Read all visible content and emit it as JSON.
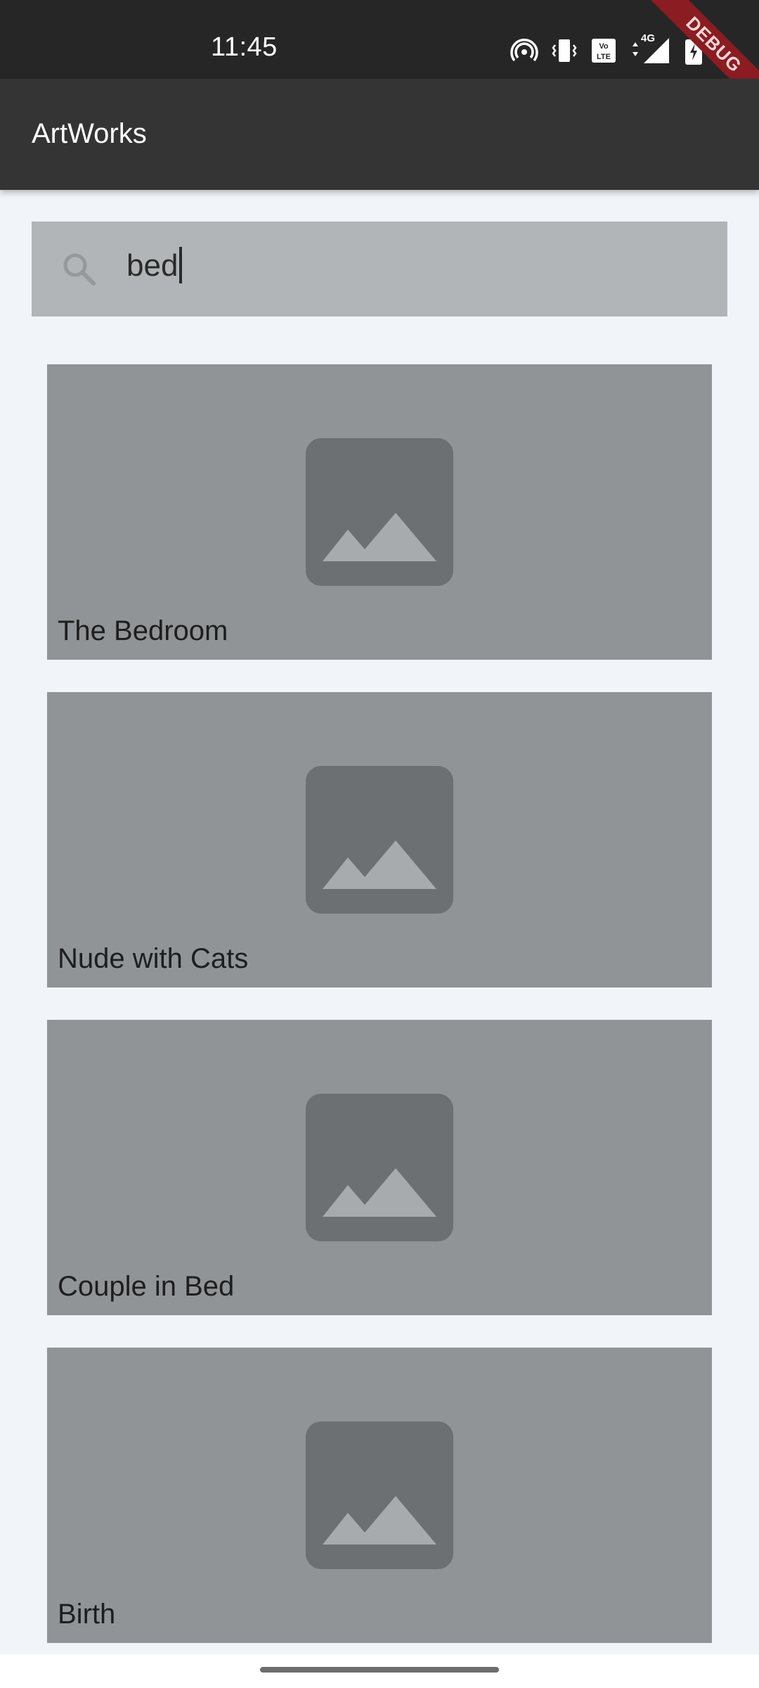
{
  "status_bar": {
    "time": "11:45",
    "icons": [
      "hotspot-icon",
      "vibrate-icon",
      "volte-icon",
      "4g-signal-icon",
      "battery-charging-icon"
    ],
    "network_label": "4G"
  },
  "debug_banner": {
    "label": "DEBUG"
  },
  "app_bar": {
    "title": "ArtWorks"
  },
  "search": {
    "value": "bed",
    "icon": "search-icon"
  },
  "results": [
    {
      "title": "The Bedroom",
      "image_icon": "image-placeholder-icon"
    },
    {
      "title": "Nude with Cats",
      "image_icon": "image-placeholder-icon"
    },
    {
      "title": "Couple in Bed",
      "image_icon": "image-placeholder-icon"
    },
    {
      "title": "Birth",
      "image_icon": "image-placeholder-icon"
    }
  ],
  "colors": {
    "status_bar": "#262626",
    "app_bar": "#343434",
    "background": "#f1f4f9",
    "search_box": "#b1b5b8",
    "card": "#909497",
    "debug_ribbon": "#8b1c22"
  }
}
